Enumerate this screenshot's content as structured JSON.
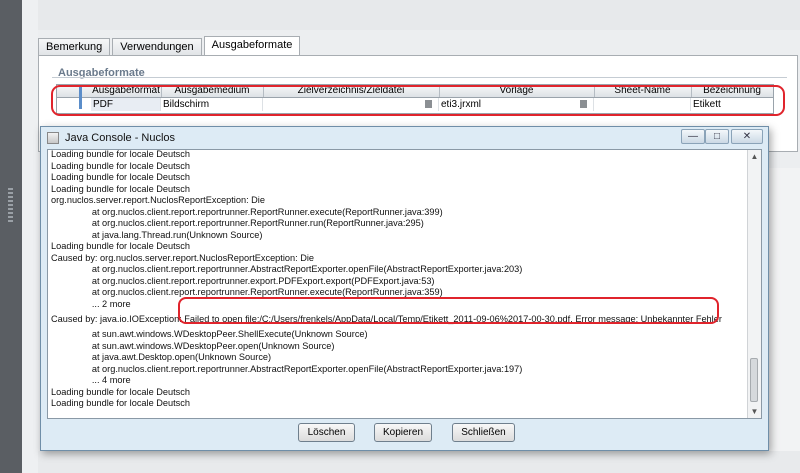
{
  "tabs": [
    {
      "label": "Bemerkung"
    },
    {
      "label": "Verwendungen"
    },
    {
      "label": "Ausgabeformate"
    }
  ],
  "section": {
    "title": "Ausgabeformate"
  },
  "table": {
    "headers": [
      "Ausgabeformat",
      "Ausgabemedium",
      "Zielverzeichnis/Zieldatei",
      "Vorlage",
      "Sheet-Name",
      "Bezeichnung"
    ],
    "row": [
      "PDF",
      "Bildschirm",
      "",
      "eti3.jrxml",
      "",
      "Etikett"
    ]
  },
  "dialog": {
    "title": "Java Console - Nuclos",
    "window_buttons": {
      "minimize": "—",
      "maximize": "□",
      "close": "✕"
    },
    "log_lines": [
      "Loading bundle for locale Deutsch",
      "Loading bundle for locale Deutsch",
      "Loading bundle for locale Deutsch",
      "Loading bundle for locale Deutsch",
      "org.nuclos.server.report.NuclosReportException: Die",
      "                at org.nuclos.client.report.reportrunner.ReportRunner.execute(ReportRunner.java:399)",
      "                at org.nuclos.client.report.reportrunner.ReportRunner.run(ReportRunner.java:295)",
      "                at java.lang.Thread.run(Unknown Source)",
      "Loading bundle for locale Deutsch",
      "Caused by: org.nuclos.server.report.NuclosReportException: Die",
      "                at org.nuclos.client.report.reportrunner.AbstractReportExporter.openFile(AbstractReportExporter.java:203)",
      "                at org.nuclos.client.report.reportrunner.export.PDFExport.export(PDFExport.java:53)",
      "                at org.nuclos.client.report.reportrunner.ReportRunner.execute(ReportRunner.java:359)",
      "                ... 2 more",
      "Caused by: java.io.IOException: Failed to open file:/C:/Users/frenkels/AppData/Local/Temp/Etikett_2011-09-06%2017-00-30.pdf. Error message: Unbekannter Fehler",
      "                at sun.awt.windows.WDesktopPeer.ShellExecute(Unknown Source)",
      "                at sun.awt.windows.WDesktopPeer.open(Unknown Source)",
      "                at java.awt.Desktop.open(Unknown Source)",
      "                at org.nuclos.client.report.reportrunner.AbstractReportExporter.openFile(AbstractReportExporter.java:197)",
      "                ... 4 more",
      "Loading bundle for locale Deutsch",
      "Loading bundle for locale Deutsch"
    ],
    "buttons": {
      "clear": "Löschen",
      "copy": "Kopieren",
      "close": "Schließen"
    }
  },
  "colors": {
    "highlight": "#e0242c",
    "dialog_bg": "#ddebf5"
  }
}
